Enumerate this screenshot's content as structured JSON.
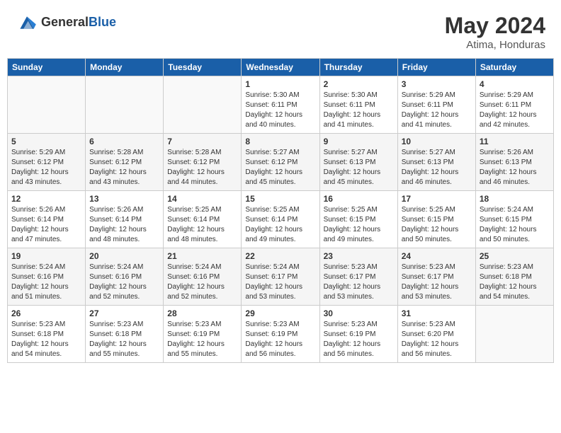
{
  "header": {
    "logo_general": "General",
    "logo_blue": "Blue",
    "month_year": "May 2024",
    "location": "Atima, Honduras"
  },
  "weekdays": [
    "Sunday",
    "Monday",
    "Tuesday",
    "Wednesday",
    "Thursday",
    "Friday",
    "Saturday"
  ],
  "weeks": [
    [
      {
        "day": "",
        "info": ""
      },
      {
        "day": "",
        "info": ""
      },
      {
        "day": "",
        "info": ""
      },
      {
        "day": "1",
        "info": "Sunrise: 5:30 AM\nSunset: 6:11 PM\nDaylight: 12 hours\nand 40 minutes."
      },
      {
        "day": "2",
        "info": "Sunrise: 5:30 AM\nSunset: 6:11 PM\nDaylight: 12 hours\nand 41 minutes."
      },
      {
        "day": "3",
        "info": "Sunrise: 5:29 AM\nSunset: 6:11 PM\nDaylight: 12 hours\nand 41 minutes."
      },
      {
        "day": "4",
        "info": "Sunrise: 5:29 AM\nSunset: 6:11 PM\nDaylight: 12 hours\nand 42 minutes."
      }
    ],
    [
      {
        "day": "5",
        "info": "Sunrise: 5:29 AM\nSunset: 6:12 PM\nDaylight: 12 hours\nand 43 minutes."
      },
      {
        "day": "6",
        "info": "Sunrise: 5:28 AM\nSunset: 6:12 PM\nDaylight: 12 hours\nand 43 minutes."
      },
      {
        "day": "7",
        "info": "Sunrise: 5:28 AM\nSunset: 6:12 PM\nDaylight: 12 hours\nand 44 minutes."
      },
      {
        "day": "8",
        "info": "Sunrise: 5:27 AM\nSunset: 6:12 PM\nDaylight: 12 hours\nand 45 minutes."
      },
      {
        "day": "9",
        "info": "Sunrise: 5:27 AM\nSunset: 6:13 PM\nDaylight: 12 hours\nand 45 minutes."
      },
      {
        "day": "10",
        "info": "Sunrise: 5:27 AM\nSunset: 6:13 PM\nDaylight: 12 hours\nand 46 minutes."
      },
      {
        "day": "11",
        "info": "Sunrise: 5:26 AM\nSunset: 6:13 PM\nDaylight: 12 hours\nand 46 minutes."
      }
    ],
    [
      {
        "day": "12",
        "info": "Sunrise: 5:26 AM\nSunset: 6:14 PM\nDaylight: 12 hours\nand 47 minutes."
      },
      {
        "day": "13",
        "info": "Sunrise: 5:26 AM\nSunset: 6:14 PM\nDaylight: 12 hours\nand 48 minutes."
      },
      {
        "day": "14",
        "info": "Sunrise: 5:25 AM\nSunset: 6:14 PM\nDaylight: 12 hours\nand 48 minutes."
      },
      {
        "day": "15",
        "info": "Sunrise: 5:25 AM\nSunset: 6:14 PM\nDaylight: 12 hours\nand 49 minutes."
      },
      {
        "day": "16",
        "info": "Sunrise: 5:25 AM\nSunset: 6:15 PM\nDaylight: 12 hours\nand 49 minutes."
      },
      {
        "day": "17",
        "info": "Sunrise: 5:25 AM\nSunset: 6:15 PM\nDaylight: 12 hours\nand 50 minutes."
      },
      {
        "day": "18",
        "info": "Sunrise: 5:24 AM\nSunset: 6:15 PM\nDaylight: 12 hours\nand 50 minutes."
      }
    ],
    [
      {
        "day": "19",
        "info": "Sunrise: 5:24 AM\nSunset: 6:16 PM\nDaylight: 12 hours\nand 51 minutes."
      },
      {
        "day": "20",
        "info": "Sunrise: 5:24 AM\nSunset: 6:16 PM\nDaylight: 12 hours\nand 52 minutes."
      },
      {
        "day": "21",
        "info": "Sunrise: 5:24 AM\nSunset: 6:16 PM\nDaylight: 12 hours\nand 52 minutes."
      },
      {
        "day": "22",
        "info": "Sunrise: 5:24 AM\nSunset: 6:17 PM\nDaylight: 12 hours\nand 53 minutes."
      },
      {
        "day": "23",
        "info": "Sunrise: 5:23 AM\nSunset: 6:17 PM\nDaylight: 12 hours\nand 53 minutes."
      },
      {
        "day": "24",
        "info": "Sunrise: 5:23 AM\nSunset: 6:17 PM\nDaylight: 12 hours\nand 53 minutes."
      },
      {
        "day": "25",
        "info": "Sunrise: 5:23 AM\nSunset: 6:18 PM\nDaylight: 12 hours\nand 54 minutes."
      }
    ],
    [
      {
        "day": "26",
        "info": "Sunrise: 5:23 AM\nSunset: 6:18 PM\nDaylight: 12 hours\nand 54 minutes."
      },
      {
        "day": "27",
        "info": "Sunrise: 5:23 AM\nSunset: 6:18 PM\nDaylight: 12 hours\nand 55 minutes."
      },
      {
        "day": "28",
        "info": "Sunrise: 5:23 AM\nSunset: 6:19 PM\nDaylight: 12 hours\nand 55 minutes."
      },
      {
        "day": "29",
        "info": "Sunrise: 5:23 AM\nSunset: 6:19 PM\nDaylight: 12 hours\nand 56 minutes."
      },
      {
        "day": "30",
        "info": "Sunrise: 5:23 AM\nSunset: 6:19 PM\nDaylight: 12 hours\nand 56 minutes."
      },
      {
        "day": "31",
        "info": "Sunrise: 5:23 AM\nSunset: 6:20 PM\nDaylight: 12 hours\nand 56 minutes."
      },
      {
        "day": "",
        "info": ""
      }
    ]
  ]
}
